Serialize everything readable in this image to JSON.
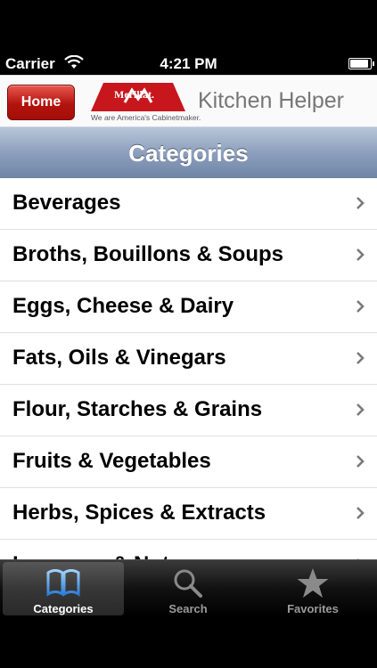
{
  "status": {
    "carrier": "Carrier",
    "time": "4:21 PM",
    "battery_level": 0.9
  },
  "header": {
    "home_label": "Home",
    "logo_text": "Merillat.",
    "logo_tagline": "We are America's Cabinetmaker.",
    "app_title": "Kitchen Helper",
    "accent_color": "#c8161d"
  },
  "page": {
    "title": "Categories"
  },
  "categories": [
    {
      "label": "Beverages"
    },
    {
      "label": "Broths, Bouillons & Soups"
    },
    {
      "label": "Eggs, Cheese & Dairy"
    },
    {
      "label": "Fats, Oils & Vinegars"
    },
    {
      "label": "Flour, Starches & Grains"
    },
    {
      "label": "Fruits & Vegetables"
    },
    {
      "label": "Herbs, Spices & Extracts"
    },
    {
      "label": "Legumes & Nuts"
    }
  ],
  "tabs": [
    {
      "label": "Categories",
      "icon": "book-icon",
      "selected": true
    },
    {
      "label": "Search",
      "icon": "search-icon",
      "selected": false
    },
    {
      "label": "Favorites",
      "icon": "star-icon",
      "selected": false
    }
  ]
}
